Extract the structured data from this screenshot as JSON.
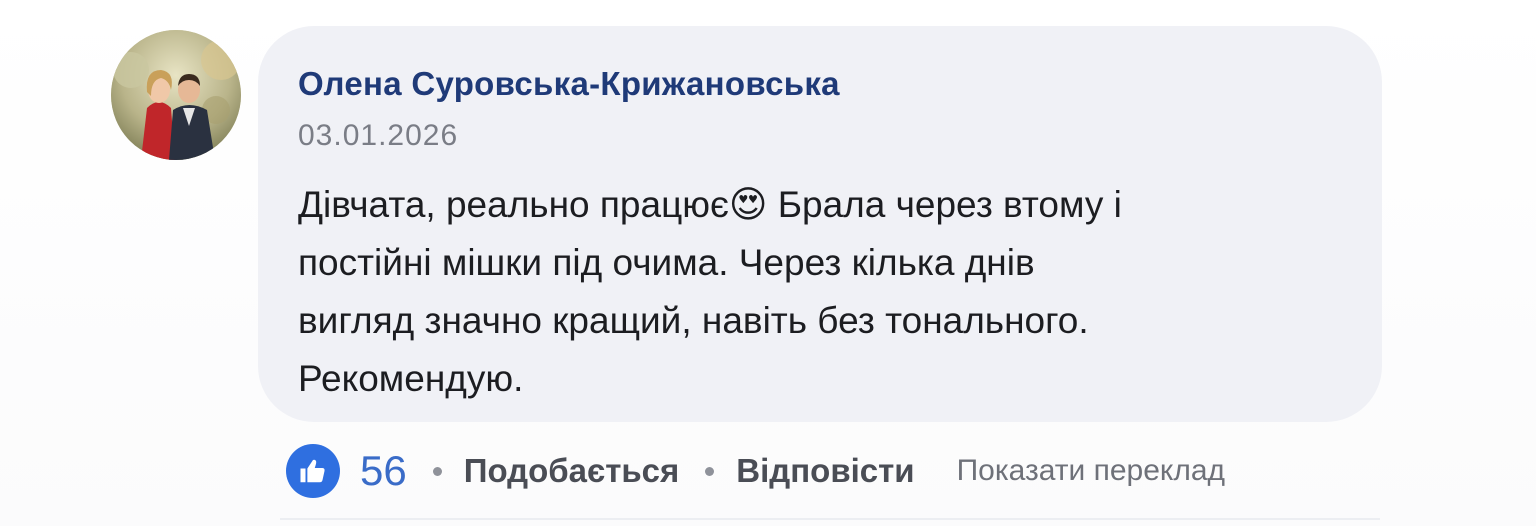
{
  "comment": {
    "author": "Олена Суровська-Крижановська",
    "date": "03.01.2026",
    "text_lines": [
      "Дівчата, реально працює😍 Брала через втому і",
      "постійні мішки під очима. Через кілька днів",
      "вигляд значно кращий, навіть без тонального.",
      "Рекомендую."
    ]
  },
  "actions": {
    "like_icon": "thumbs-up-icon",
    "like_count": "56",
    "like_label": "Подобається",
    "reply_label": "Відповісти",
    "translate_label": "Показати переклад"
  },
  "colors": {
    "author": "#1f3a78",
    "like_accent": "#2f6fe0",
    "bubble": "#f0f1f6"
  }
}
